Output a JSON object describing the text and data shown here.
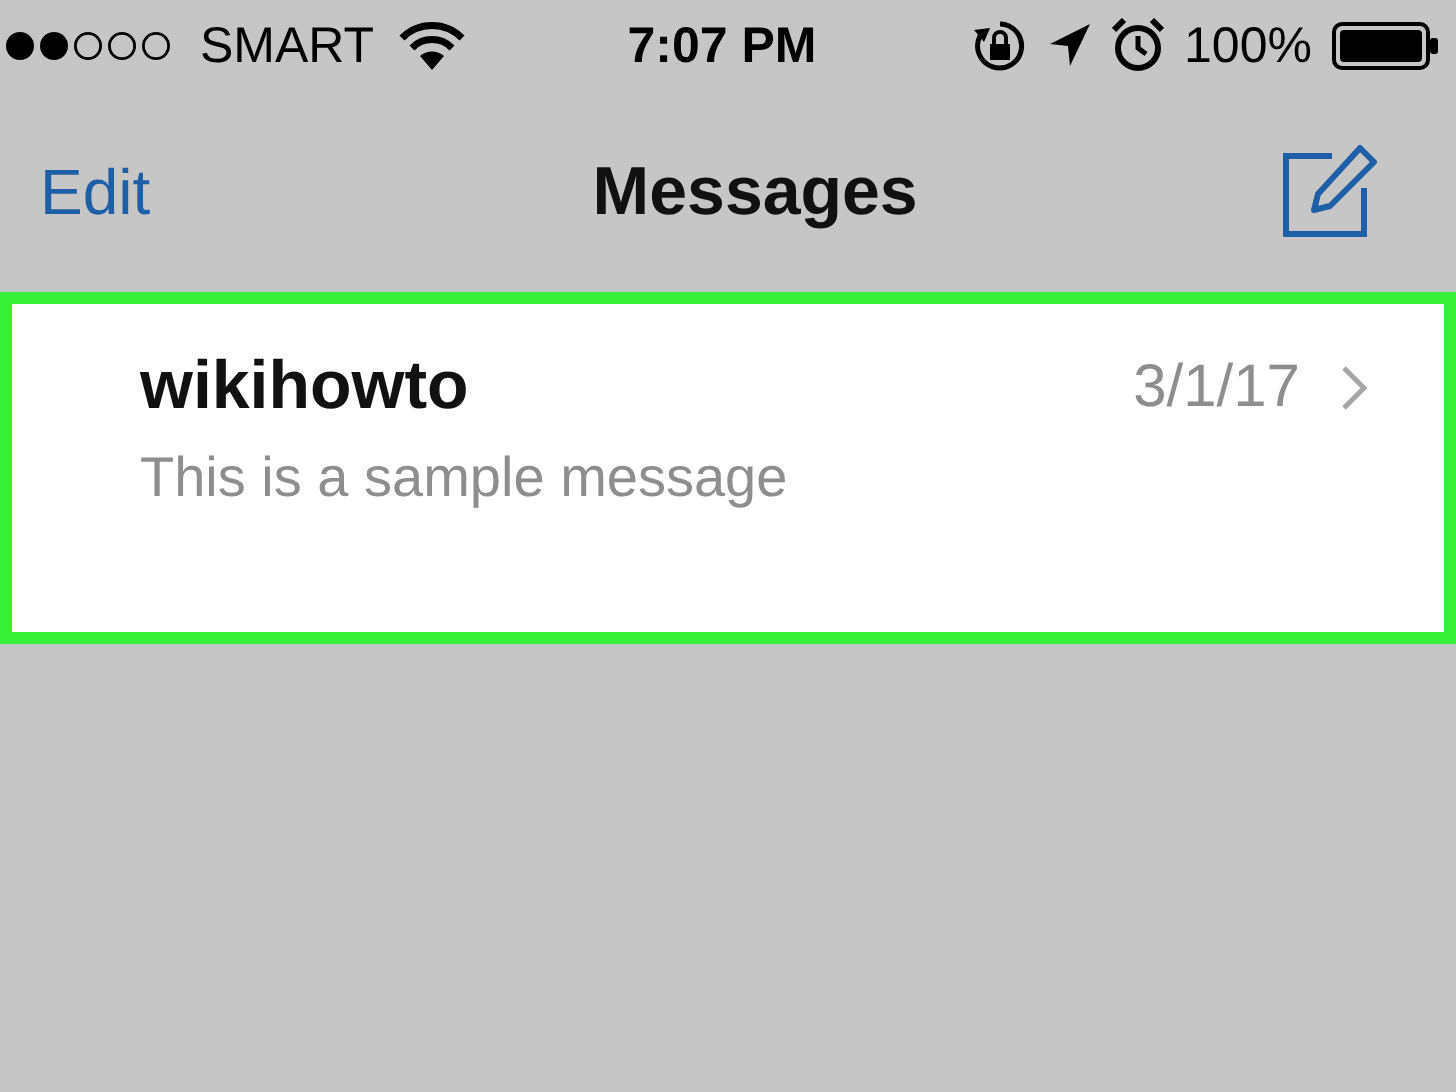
{
  "status_bar": {
    "carrier": "SMART",
    "time": "7:07 PM",
    "battery": "100%"
  },
  "nav_bar": {
    "edit": "Edit",
    "title": "Messages"
  },
  "conversations": [
    {
      "name": "wikihowto",
      "date": "3/1/17",
      "preview": "This is a sample message",
      "highlighted": true
    }
  ]
}
